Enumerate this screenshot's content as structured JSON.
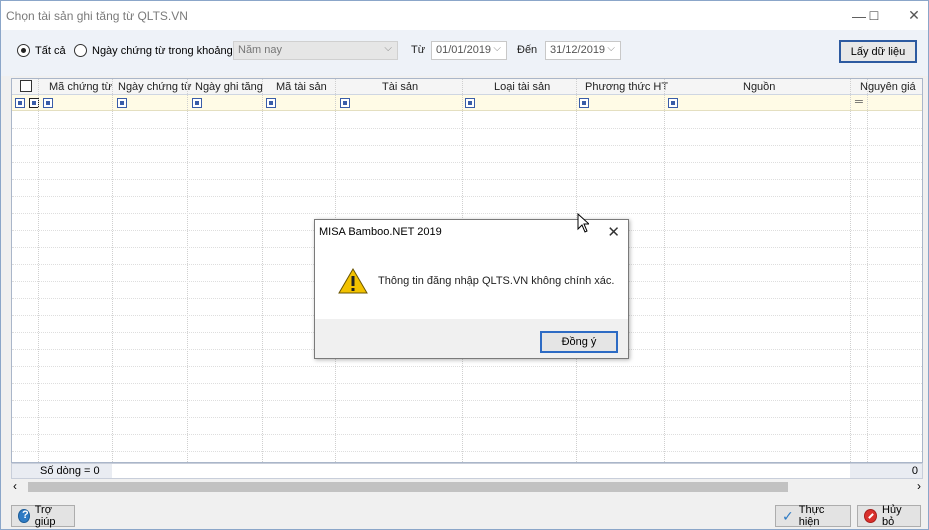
{
  "window": {
    "title": "Chọn tài sản ghi tăng từ QLTS.VN",
    "minimize": "—",
    "maximize": "☐",
    "close": "✕"
  },
  "toolbar": {
    "radio_all": "Tất cả",
    "radio_range": "Ngày chứng từ trong khoảng",
    "period_value": "Năm nay",
    "from_label": "Từ",
    "from_value": "01/01/2019",
    "to_label": "Đến",
    "to_value": "31/12/2019",
    "fetch_button": "Lấy dữ liệu"
  },
  "grid": {
    "columns": [
      "Mã chứng từ",
      "Ngày chứng từ",
      "Ngày ghi tăng",
      "Mã tài sản",
      "Tài sản",
      "Loại tài sản",
      "Phương thức HT",
      "Nguồn",
      "Nguyên giá"
    ],
    "row_count_label": "Số dòng = 0",
    "total_value": "0"
  },
  "bottom": {
    "help_button": "Trợ giúp",
    "execute_button": "Thực hiện",
    "cancel_button": "Hủy bỏ"
  },
  "dialog": {
    "title": "MISA Bamboo.NET 2019",
    "message": "Thông tin đăng nhập QLTS.VN không chính xác.",
    "ok_button": "Đồng ý"
  },
  "icons": {
    "warning": "warning-icon",
    "help": "help-icon",
    "check": "check-icon",
    "cancel": "cancel-icon"
  },
  "colors": {
    "accent": "#2d5aa0",
    "warning": "#f2c200",
    "cancel": "#d9302c",
    "check": "#2e7bc4"
  }
}
